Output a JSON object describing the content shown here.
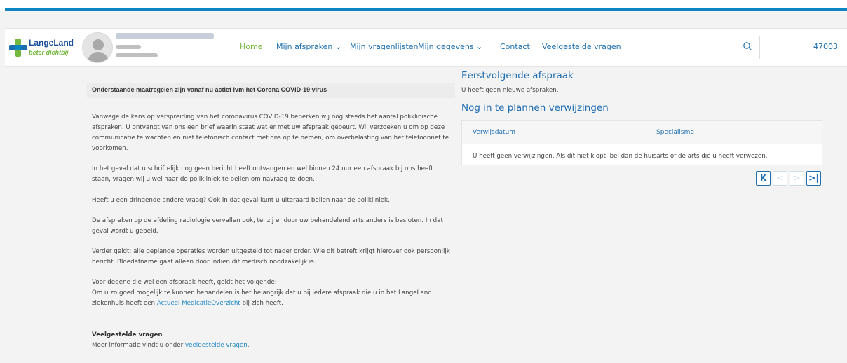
{
  "brand": {
    "name": "LangeLand",
    "tagline": "beter dichtbij"
  },
  "nav": {
    "items": [
      {
        "label": "Home",
        "active": true
      },
      {
        "label": "Mijn afspraken ⌄"
      },
      {
        "label": "Mijn vragenlijsten"
      },
      {
        "label": "Mijn gegevens ⌄"
      },
      {
        "label": "Contact"
      },
      {
        "label": "Veelgestelde vragen"
      }
    ],
    "user_number": "47003"
  },
  "notice": {
    "title": "Onderstaande maatregelen zijn vanaf nu actief ivm het Corona COVID-19 virus",
    "p1": "Vanwege de kans op verspreiding van het coronavirus COVID-19 beperken wij nog steeds het aantal poliklinische afspraken. U ontvangt van ons een brief waarin staat wat er met uw afspraak gebeurt. Wij verzoeken u om op deze communicatie te wachten en niet telefonisch contact met ons op te nemen, om overbelasting van het telefoonnet te voorkomen.",
    "p2": "In het geval dat u schriftelijk nog geen bericht heeft ontvangen en wel binnen 24 uur een afspraak bij ons heeft staan, vragen wij u wel naar de polikliniek te bellen om navraag te doen.",
    "p3": "Heeft u een dringende andere vraag? Ook in dat geval kunt u uiteraard bellen naar de polikliniek.",
    "p4": "De afspraken op de afdeling radiologie vervallen ook, tenzij er door uw behandelend arts anders is besloten. In dat geval wordt u gebeld.",
    "p5": "Verder geldt: alle geplande operaties worden uitgesteld tot nader order. Wie dit betreft krijgt hierover ook persoonlijk bericht. Bloedafname gaat alleen door indien dit medisch noodzakelijk is.",
    "p6_line1": "Voor degene die wel een afspraak heeft, geldt het volgende:",
    "p6_line2_pre": "Om u zo goed mogelijk te kunnen behandelen is het belangrijk dat u bij iedere afspraak die u in het LangeLand ziekenhuis heeft een ",
    "p6_link": "Actueel MedicatieOverzicht",
    "p6_post": " bij zich heeft.",
    "faq_title": "Veelgestelde vragen",
    "faq_pre": "Meer informatie vindt u onder ",
    "faq_link": "veelgestelde vragen",
    "faq_post": "."
  },
  "appointments": {
    "title": "Eerstvolgende afspraak",
    "empty": "U heeft geen nieuwe afspraken."
  },
  "referrals": {
    "title": "Nog in te plannen verwijzingen",
    "columns": [
      "Verwijsdatum",
      "Specialisme"
    ],
    "empty": "U heeft geen verwijzingen. Als dit niet klopt, bel dan de huisarts of de arts die u heeft verwezen."
  },
  "pager": {
    "first": "K",
    "prev": "<",
    "next": ">",
    "last": ">|"
  },
  "colors": {
    "accent_blue": "#0f86c3",
    "nav_blue": "#1b6fb0",
    "brand_green": "#74b83e",
    "heading_blue": "#1f6eb1"
  }
}
